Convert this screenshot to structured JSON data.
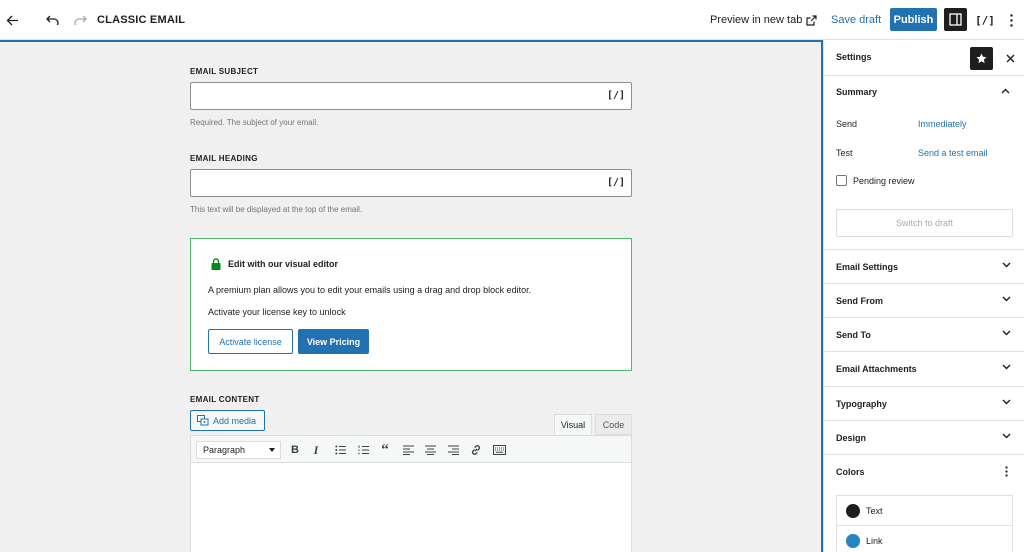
{
  "header": {
    "title": "CLASSIC EMAIL",
    "preview_label": "Preview in new tab",
    "save_draft_label": "Save draft",
    "publish_label": "Publish",
    "shortcode_label": "[/]"
  },
  "editor": {
    "subject": {
      "label": "EMAIL SUBJECT",
      "value": "",
      "shortcode": "[/]",
      "help": "Required. The subject of your email."
    },
    "heading": {
      "label": "EMAIL HEADING",
      "value": "",
      "shortcode": "[/]",
      "help": "This text will be displayed at the top of the email."
    },
    "premium": {
      "title": "Edit with our visual editor",
      "description": "A premium plan allows you to edit your emails using a drag and drop block editor.",
      "unlock_text": "Activate your license key to unlock",
      "activate_label": "Activate license",
      "pricing_label": "View Pricing"
    },
    "content": {
      "label": "EMAIL CONTENT",
      "add_media_label": "Add media",
      "tab_visual": "Visual",
      "tab_code": "Code",
      "format_value": "Paragraph",
      "toolbar_bold": "B",
      "toolbar_italic": "I",
      "toolbar_quote": "“"
    }
  },
  "sidebar": {
    "title": "Settings",
    "summary": {
      "title": "Summary",
      "send_label": "Send",
      "send_value": "Immediately",
      "test_label": "Test",
      "test_value": "Send a test email",
      "pending_label": "Pending review",
      "switch_label": "Switch to draft"
    },
    "panels": [
      {
        "title": "Email Settings"
      },
      {
        "title": "Send From"
      },
      {
        "title": "Send To"
      },
      {
        "title": "Email Attachments"
      },
      {
        "title": "Typography"
      },
      {
        "title": "Design"
      },
      {
        "title": "Colors"
      }
    ],
    "colors": [
      {
        "label": "Text",
        "color": "#1e1e1e"
      },
      {
        "label": "Link",
        "color": "#2683c6"
      }
    ]
  },
  "theme": {
    "accent": "#2271b1",
    "success": "#4ab866"
  }
}
